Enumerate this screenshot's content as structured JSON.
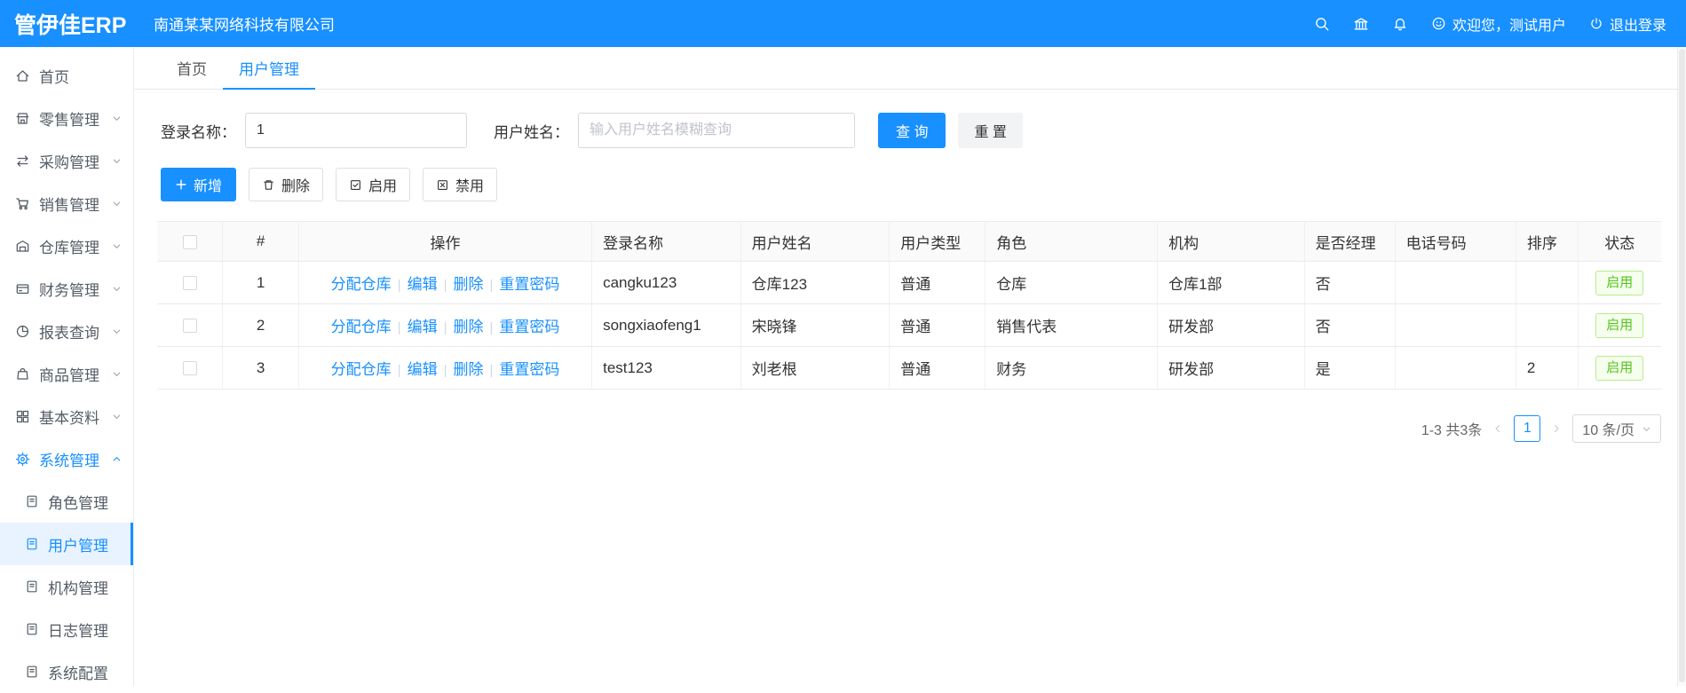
{
  "topbar": {
    "logo": "管伊佳ERP",
    "company": "南通某某网络科技有限公司",
    "welcome": "欢迎您，测试用户",
    "logout": "退出登录"
  },
  "sidebar": {
    "items": [
      {
        "label": "首页"
      },
      {
        "label": "零售管理"
      },
      {
        "label": "采购管理"
      },
      {
        "label": "销售管理"
      },
      {
        "label": "仓库管理"
      },
      {
        "label": "财务管理"
      },
      {
        "label": "报表查询"
      },
      {
        "label": "商品管理"
      },
      {
        "label": "基本资料"
      },
      {
        "label": "系统管理"
      }
    ],
    "subitems": [
      {
        "label": "角色管理"
      },
      {
        "label": "用户管理"
      },
      {
        "label": "机构管理"
      },
      {
        "label": "日志管理"
      },
      {
        "label": "系统配置"
      }
    ]
  },
  "tabs": [
    {
      "label": "首页"
    },
    {
      "label": "用户管理"
    }
  ],
  "filters": {
    "login_label": "登录名称：",
    "login_value": "1",
    "name_label": "用户姓名：",
    "name_placeholder": "输入用户姓名模糊查询",
    "search": "查 询",
    "reset": "重 置"
  },
  "toolbar": {
    "add": "新增",
    "delete": "删除",
    "enable": "启用",
    "disable": "禁用"
  },
  "table": {
    "headers": [
      "#",
      "操作",
      "登录名称",
      "用户姓名",
      "用户类型",
      "角色",
      "机构",
      "是否经理",
      "电话号码",
      "排序",
      "状态"
    ],
    "op_links": [
      "分配仓库",
      "编辑",
      "删除",
      "重置密码"
    ],
    "op_separator": "|",
    "rows": [
      {
        "index": "1",
        "login": "cangku123",
        "name": "仓库123",
        "type": "普通",
        "role": "仓库",
        "org": "仓库1部",
        "manager": "否",
        "phone": "",
        "sort": "",
        "status": "启用"
      },
      {
        "index": "2",
        "login": "songxiaofeng1",
        "name": "宋晓锋",
        "type": "普通",
        "role": "销售代表",
        "org": "研发部",
        "manager": "否",
        "phone": "",
        "sort": "",
        "status": "启用"
      },
      {
        "index": "3",
        "login": "test123",
        "name": "刘老根",
        "type": "普通",
        "role": "财务",
        "org": "研发部",
        "manager": "是",
        "phone": "",
        "sort": "2",
        "status": "启用"
      }
    ]
  },
  "pagination": {
    "total": "1-3 共3条",
    "page": "1",
    "page_size": "10 条/页"
  },
  "colors": {
    "primary": "#1890ff",
    "success": "#52c41a"
  }
}
